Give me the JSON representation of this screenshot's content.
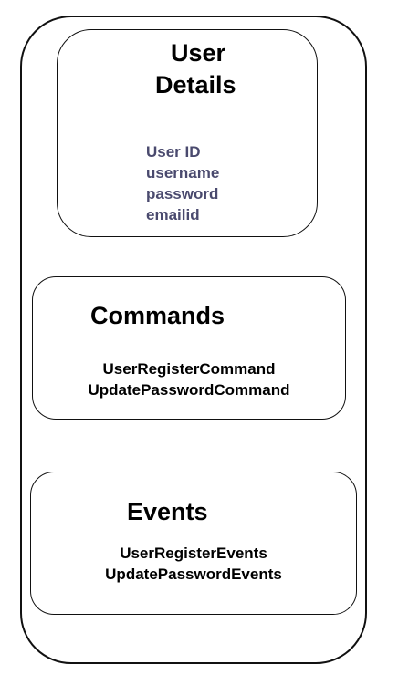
{
  "user_details": {
    "title_line1": "User",
    "title_line2": "Details",
    "attributes": [
      "User ID",
      "username",
      "password",
      "emailid"
    ]
  },
  "commands": {
    "title": "Commands",
    "items": [
      "UserRegisterCommand",
      "UpdatePasswordCommand"
    ]
  },
  "events": {
    "title": "Events",
    "items": [
      "UserRegisterEvents",
      "UpdatePasswordEvents"
    ]
  },
  "colors": {
    "attribute_text": "#4a4a6e",
    "border": "#111111"
  }
}
